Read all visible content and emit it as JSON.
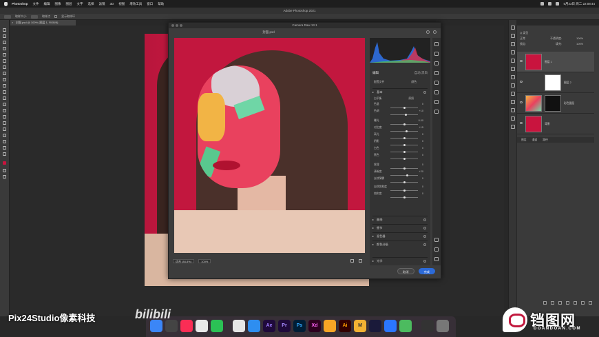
{
  "menubar": {
    "app_name": "Photoshop",
    "items": [
      "文件",
      "编辑",
      "图像",
      "图层",
      "文字",
      "选择",
      "滤镜",
      "3D",
      "视图",
      "增效工具",
      "窗口",
      "帮助"
    ],
    "clock": "5月23日 周二 22:08:44"
  },
  "ps": {
    "window_title": "Adobe Photoshop 2021",
    "doc_tab": "封面.psd @ 100% (图层 1, RGB/8)"
  },
  "options": {
    "sample_label": "取样大小:",
    "sample_value": "取样点",
    "sample_all": "显示取样环"
  },
  "dialog": {
    "title": "Camera Raw 13.1",
    "filename": "封面.psd",
    "zoom_label": "适合 (84.8%)",
    "zoom_value": "100%",
    "edit_label": "编辑",
    "profile_label": "配置文件",
    "profile_value": "颜色",
    "treatment_label": "彩色",
    "auto_label": "自动",
    "bw_label": "黑白",
    "basic_label": "基本",
    "white_balance_label": "白平衡",
    "white_balance_value": "原照",
    "cancel_label": "取消",
    "done_label": "完成"
  },
  "adjustments": [
    {
      "label": "色温",
      "value": "0",
      "pos": 0.5
    },
    {
      "label": "色调",
      "value": "+10",
      "pos": 0.55
    },
    {
      "label": "曝光",
      "value": "0.00",
      "pos": 0.5
    },
    {
      "label": "对比度",
      "value": "+15",
      "pos": 0.58
    },
    {
      "label": "高光",
      "value": "0",
      "pos": 0.5
    },
    {
      "label": "阴影",
      "value": "0",
      "pos": 0.5
    },
    {
      "label": "白色",
      "value": "0",
      "pos": 0.5
    },
    {
      "label": "黑色",
      "value": "0",
      "pos": 0.5
    },
    {
      "label": "纹理",
      "value": "0",
      "pos": 0.5
    },
    {
      "label": "清晰度",
      "value": "+20",
      "pos": 0.6
    },
    {
      "label": "去除薄雾",
      "value": "0",
      "pos": 0.5
    },
    {
      "label": "自然饱和度",
      "value": "0",
      "pos": 0.5
    },
    {
      "label": "饱和度",
      "value": "0",
      "pos": 0.5
    }
  ],
  "sections": [
    "曲线",
    "细节",
    "混色器",
    "颜色分级",
    "光学"
  ],
  "layers": {
    "tab_layers": "图层",
    "tab_channels": "通道",
    "tab_paths": "路径",
    "kind_label": "Q 类型",
    "blend_mode": "正常",
    "opacity_label": "不透明度:",
    "opacity_value": "100%",
    "lock_label": "锁定:",
    "fill_label": "填充:",
    "fill_value": "100%",
    "items": [
      {
        "name": "图层 1",
        "selected": true
      },
      {
        "name": "图层 2",
        "selected": false
      },
      {
        "name": "彩色图层",
        "selected": false
      },
      {
        "name": "背景",
        "selected": false
      }
    ]
  },
  "colors": {
    "accent_red": "#c9143e",
    "primary_button": "#2c6ad8"
  },
  "watermark": {
    "studio": "Pix24Studio像素科技",
    "bili": "bilibili",
    "site": "铛图网",
    "site_url": "DOANDOAN.COM"
  },
  "dock": [
    "Ae",
    "Pr",
    "Ps",
    "Xd",
    "Ai",
    "M"
  ]
}
